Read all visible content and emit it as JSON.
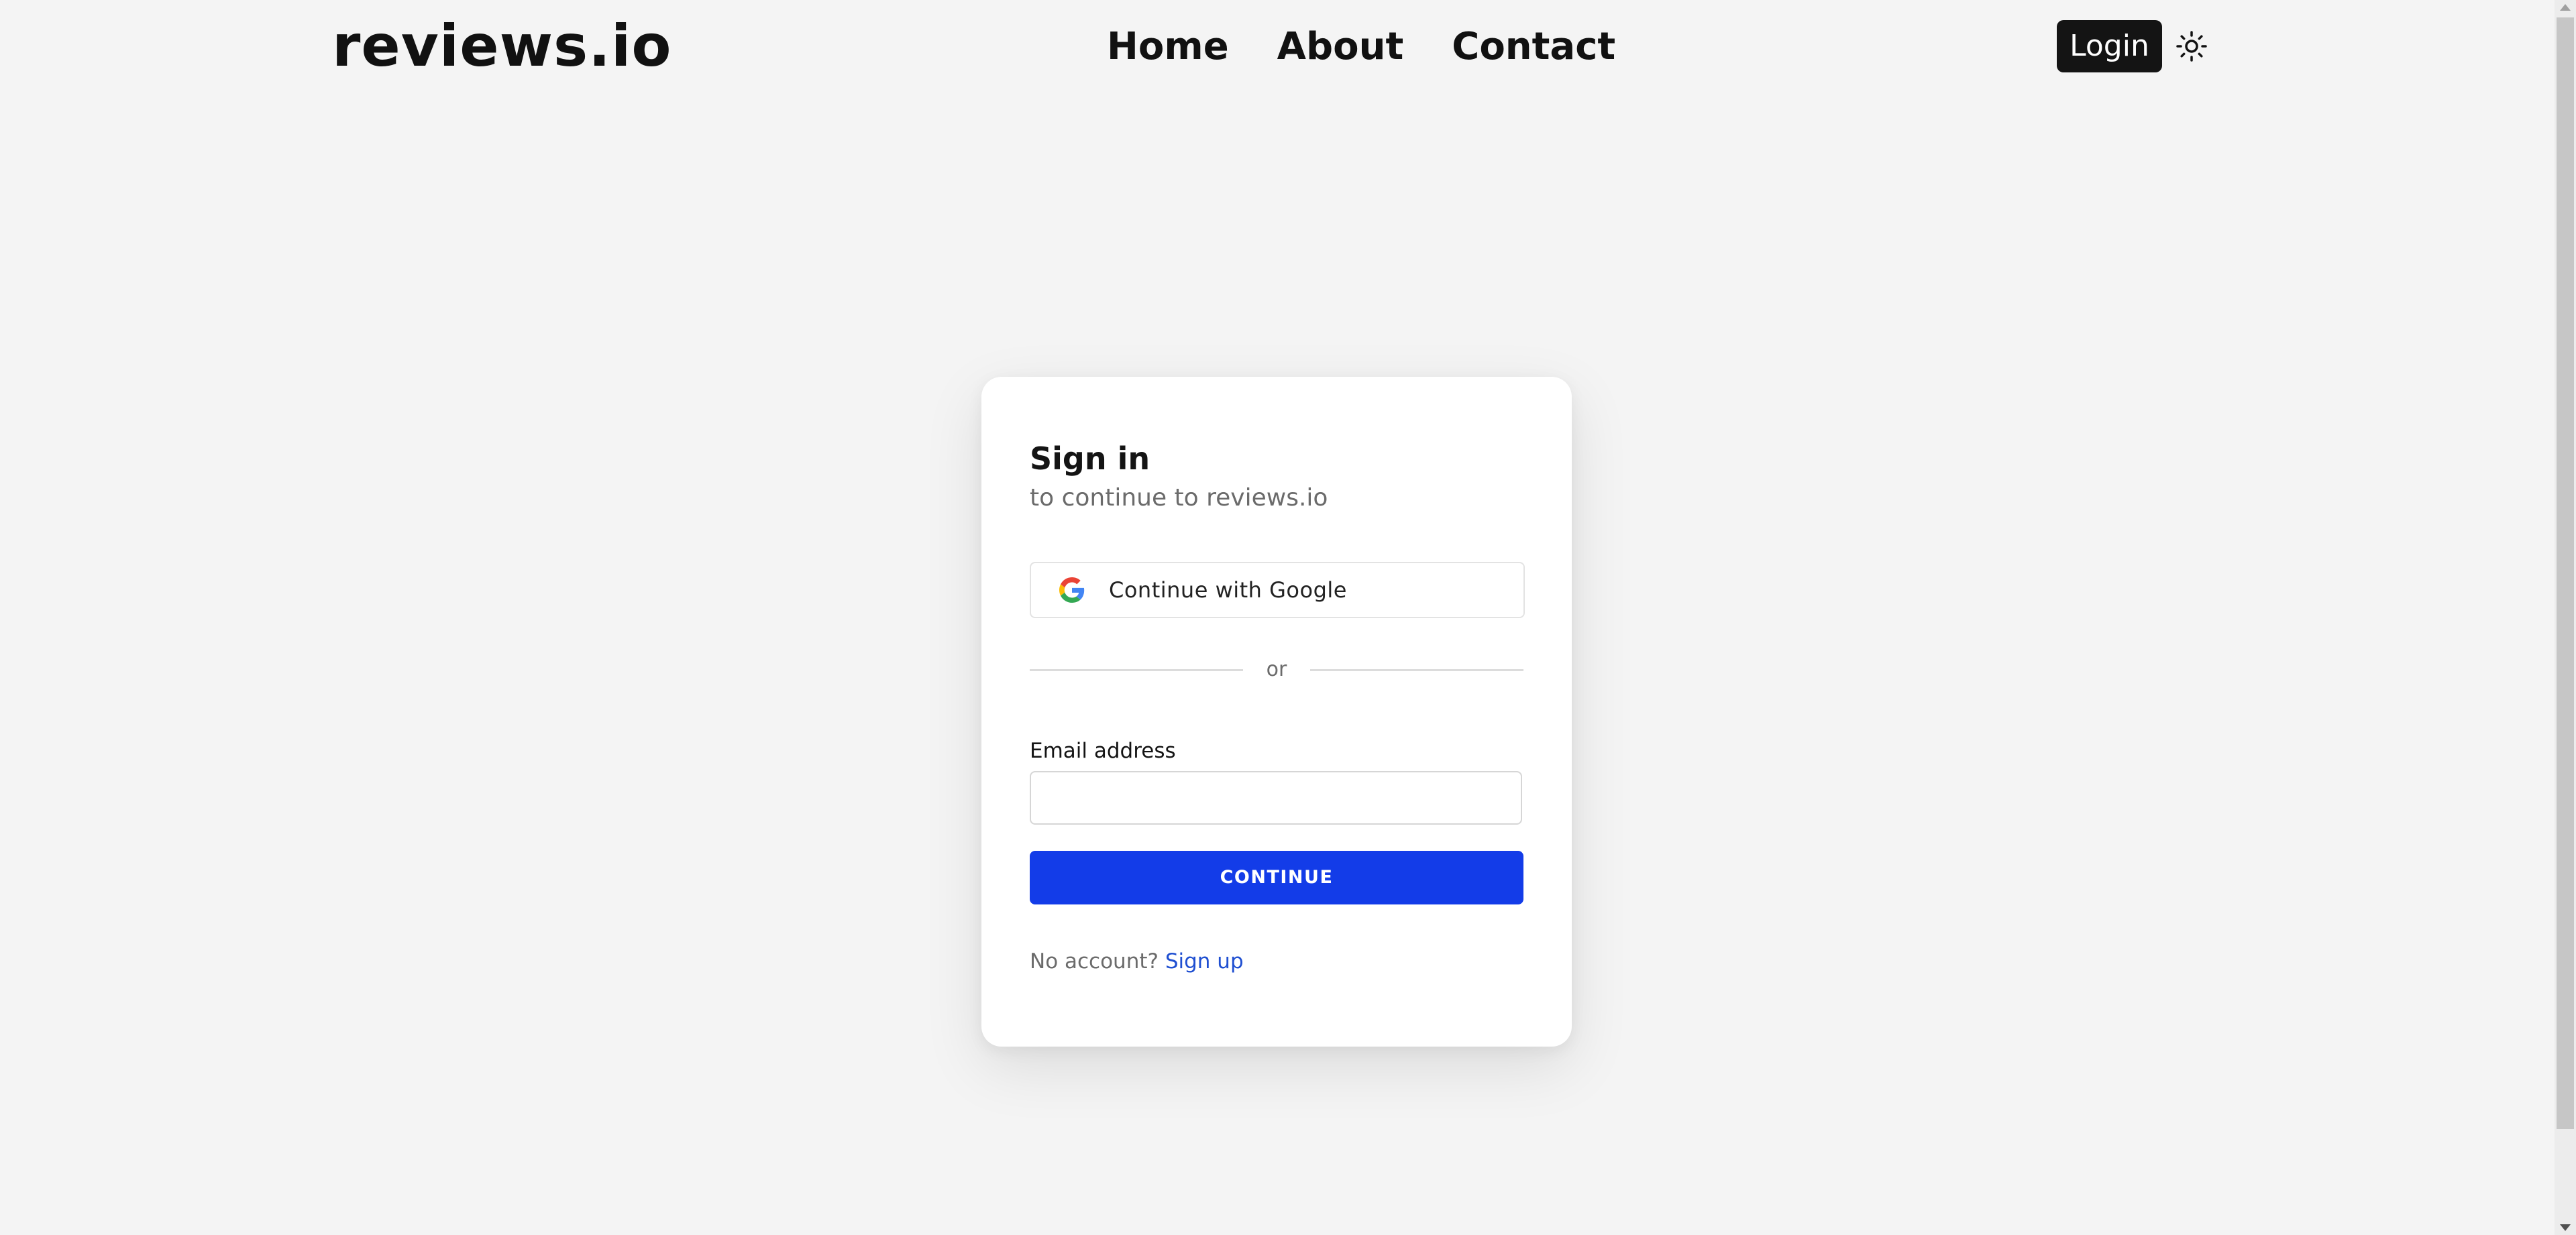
{
  "header": {
    "brand": "reviews.io",
    "nav": [
      {
        "label": "Home"
      },
      {
        "label": "About"
      },
      {
        "label": "Contact"
      }
    ],
    "login_label": "Login",
    "theme_icon": "sun-icon"
  },
  "signin_card": {
    "title": "Sign in",
    "subtitle": "to continue to reviews.io",
    "google_button_label": "Continue with Google",
    "divider_text": "or",
    "email_label": "Email address",
    "email_value": "",
    "email_placeholder": "",
    "continue_label": "CONTINUE",
    "no_account_text": "No account?",
    "signup_link": "Sign up"
  },
  "colors": {
    "background": "#f4f4f4",
    "primary_button": "#133ce8",
    "link": "#1f4fd1",
    "login_button": "#141414"
  }
}
